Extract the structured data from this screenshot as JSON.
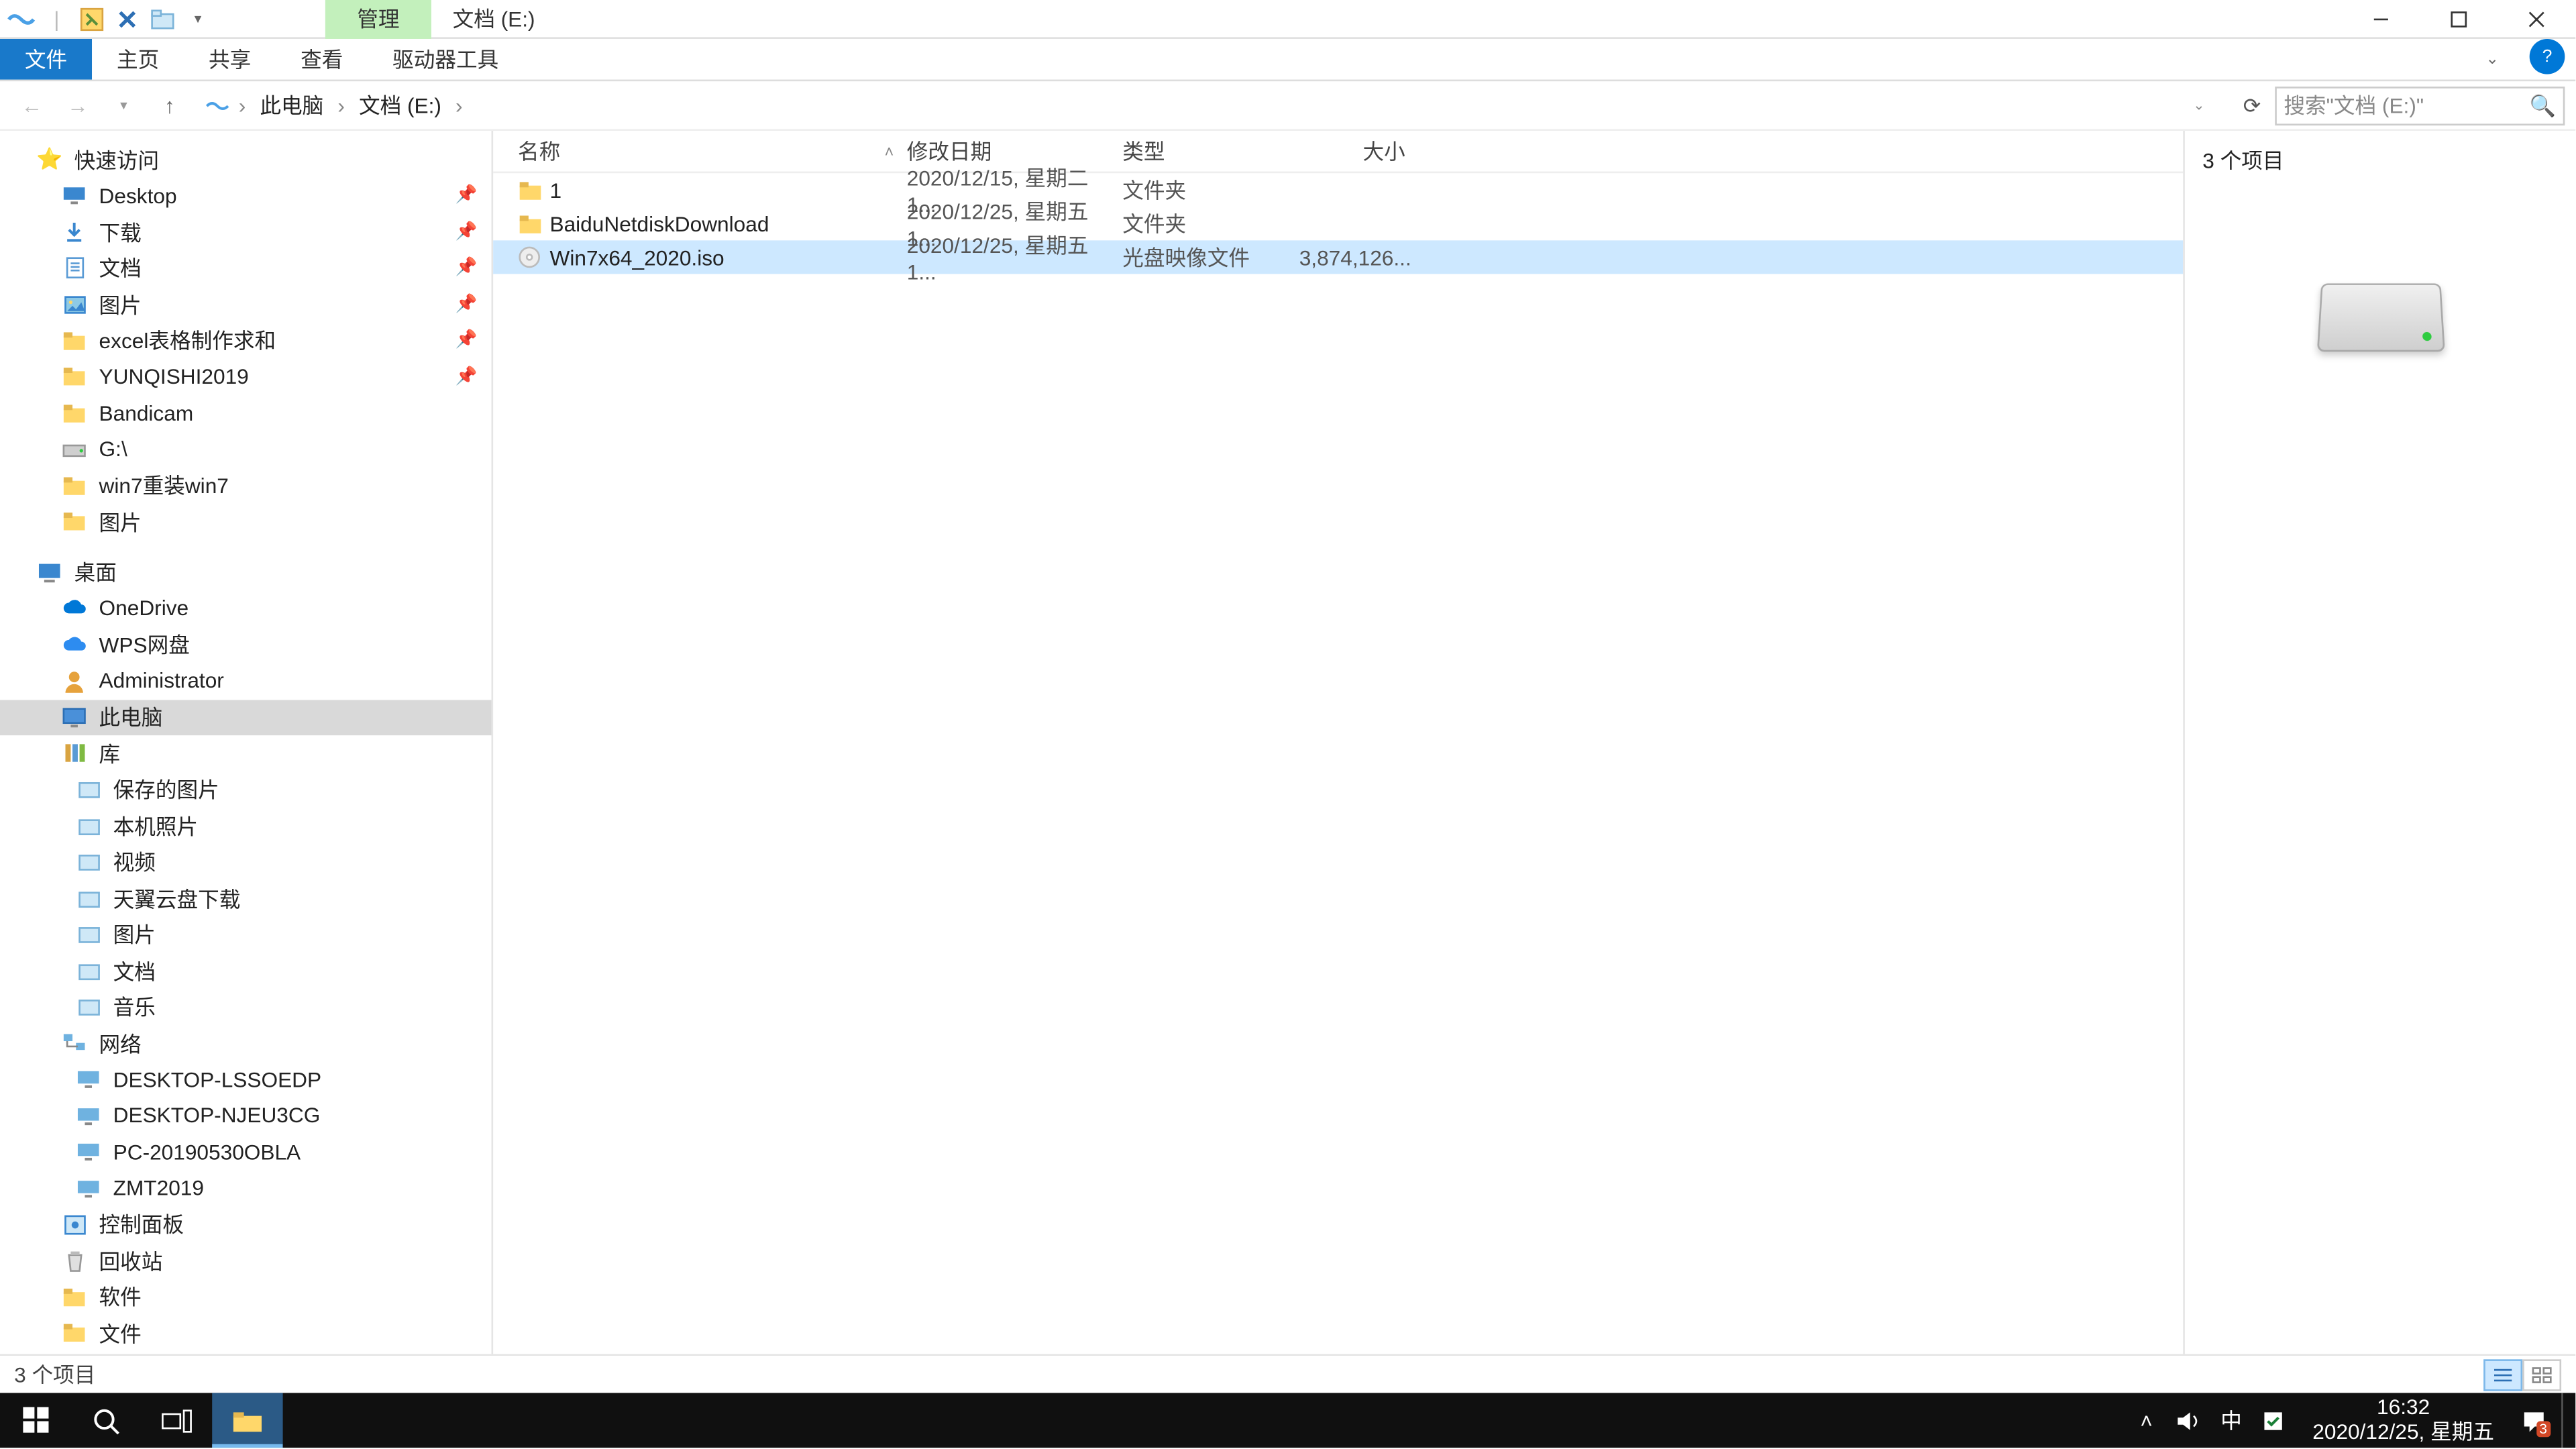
{
  "title_tab_context": "管理",
  "window_title": "文档 (E:)",
  "ribbon": {
    "file": "文件",
    "home": "主页",
    "share": "共享",
    "view": "查看",
    "drivetools": "驱动器工具"
  },
  "breadcrumbs": [
    "此电脑",
    "文档 (E:)"
  ],
  "search_placeholder": "搜索\"文档 (E:)\"",
  "columns": {
    "name": "名称",
    "date": "修改日期",
    "type": "类型",
    "size": "大小"
  },
  "files": [
    {
      "icon": "folder",
      "name": "1",
      "date": "2020/12/15, 星期二 1...",
      "type": "文件夹",
      "size": "",
      "selected": false
    },
    {
      "icon": "folder",
      "name": "BaiduNetdiskDownload",
      "date": "2020/12/25, 星期五 1...",
      "type": "文件夹",
      "size": "",
      "selected": false
    },
    {
      "icon": "iso",
      "name": "Win7x64_2020.iso",
      "date": "2020/12/25, 星期五 1...",
      "type": "光盘映像文件",
      "size": "3,874,126...",
      "selected": true
    }
  ],
  "preview_count": "3 个项目",
  "status_text": "3 个项目",
  "nav": {
    "quick": "快速访问",
    "quick_items": [
      {
        "label": "Desktop",
        "icon": "desktop",
        "pin": true
      },
      {
        "label": "下载",
        "icon": "download",
        "pin": true
      },
      {
        "label": "文档",
        "icon": "doc",
        "pin": true
      },
      {
        "label": "图片",
        "icon": "pic",
        "pin": true
      },
      {
        "label": "excel表格制作求和",
        "icon": "folder",
        "pin": true
      },
      {
        "label": "YUNQISHI2019",
        "icon": "folder",
        "pin": true
      },
      {
        "label": "Bandicam",
        "icon": "folder",
        "pin": false
      },
      {
        "label": "G:\\",
        "icon": "drive",
        "pin": false
      },
      {
        "label": "win7重装win7",
        "icon": "folder",
        "pin": false
      },
      {
        "label": "图片",
        "icon": "folder",
        "pin": false
      }
    ],
    "desktop": "桌面",
    "desktop_items": [
      {
        "label": "OneDrive",
        "icon": "cloud"
      },
      {
        "label": "WPS网盘",
        "icon": "cloud2"
      },
      {
        "label": "Administrator",
        "icon": "user"
      },
      {
        "label": "此电脑",
        "icon": "pc",
        "selected": true
      },
      {
        "label": "库",
        "icon": "lib"
      }
    ],
    "lib_items": [
      {
        "label": "保存的图片"
      },
      {
        "label": "本机照片"
      },
      {
        "label": "视频"
      },
      {
        "label": "天翼云盘下载"
      },
      {
        "label": "图片"
      },
      {
        "label": "文档"
      },
      {
        "label": "音乐"
      }
    ],
    "network": "网络",
    "network_items": [
      {
        "label": "DESKTOP-LSSOEDP"
      },
      {
        "label": "DESKTOP-NJEU3CG"
      },
      {
        "label": "PC-20190530OBLA"
      },
      {
        "label": "ZMT2019"
      }
    ],
    "extras": [
      {
        "label": "控制面板",
        "icon": "cp"
      },
      {
        "label": "回收站",
        "icon": "bin"
      },
      {
        "label": "软件",
        "icon": "folder"
      },
      {
        "label": "文件",
        "icon": "folder"
      }
    ]
  },
  "clock": {
    "time": "16:32",
    "date": "2020/12/25, 星期五"
  },
  "ime": "中",
  "action_badge": "3"
}
